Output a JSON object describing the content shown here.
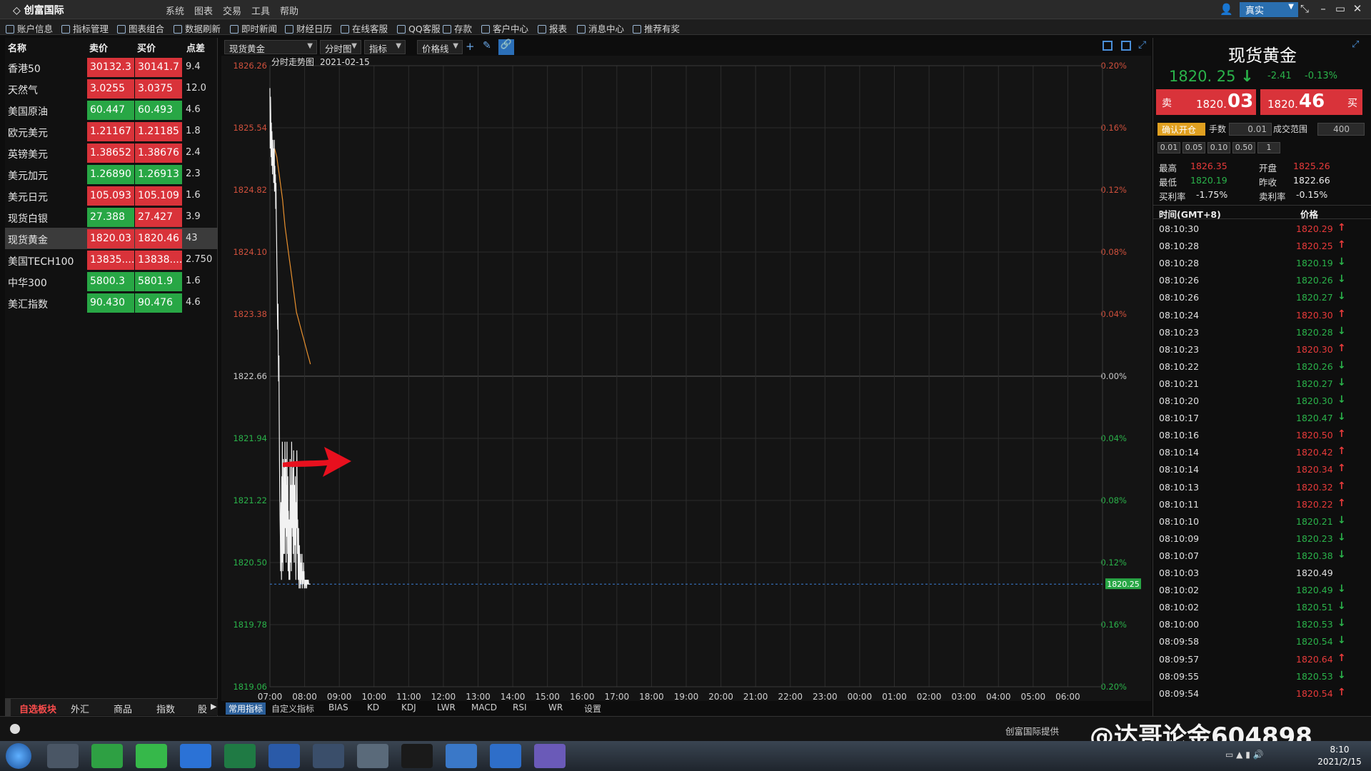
{
  "app": {
    "title": "创富国际",
    "menu": [
      "系统",
      "图表",
      "交易",
      "工具",
      "帮助"
    ],
    "mode": "真实"
  },
  "toolbar": {
    "items": [
      "账户信息",
      "指标管理",
      "图表组合",
      "数据刷新",
      "即时新闻",
      "财经日历",
      "在线客服",
      "QQ客服",
      "存款",
      "客户中心",
      "报表",
      "消息中心",
      "推荐有奖"
    ]
  },
  "quotes": {
    "headers": {
      "name": "名称",
      "sell": "卖价",
      "buy": "买价",
      "spread": "点差"
    },
    "rows": [
      {
        "name": "香港50",
        "sell": "30132.3",
        "buy": "30141.7",
        "spread": "9.4",
        "sell_color": "red",
        "buy_color": "red"
      },
      {
        "name": "天然气",
        "sell": "3.0255",
        "buy": "3.0375",
        "spread": "12.0",
        "sell_color": "red",
        "buy_color": "red"
      },
      {
        "name": "美国原油",
        "sell": "60.447",
        "buy": "60.493",
        "spread": "4.6",
        "sell_color": "green",
        "buy_color": "green"
      },
      {
        "name": "欧元美元",
        "sell": "1.21167",
        "buy": "1.21185",
        "spread": "1.8",
        "sell_color": "red",
        "buy_color": "red"
      },
      {
        "name": "英镑美元",
        "sell": "1.38652",
        "buy": "1.38676",
        "spread": "2.4",
        "sell_color": "red",
        "buy_color": "red"
      },
      {
        "name": "美元加元",
        "sell": "1.26890",
        "buy": "1.26913",
        "spread": "2.3",
        "sell_color": "green",
        "buy_color": "green"
      },
      {
        "name": "美元日元",
        "sell": "105.093",
        "buy": "105.109",
        "spread": "1.6",
        "sell_color": "red",
        "buy_color": "red"
      },
      {
        "name": "现货白银",
        "sell": "27.388",
        "buy": "27.427",
        "spread": "3.9",
        "sell_color": "green",
        "buy_color": "red"
      },
      {
        "name": "现货黄金",
        "sell": "1820.03",
        "buy": "1820.46",
        "spread": "43",
        "sell_color": "red",
        "buy_color": "red"
      },
      {
        "name": "美国TECH100",
        "sell": "13835....",
        "buy": "13838....",
        "spread": "2.750",
        "sell_color": "red",
        "buy_color": "red"
      },
      {
        "name": "中华300",
        "sell": "5800.3",
        "buy": "5801.9",
        "spread": "1.6",
        "sell_color": "green",
        "buy_color": "green"
      },
      {
        "name": "美汇指数",
        "sell": "90.430",
        "buy": "90.476",
        "spread": "4.6",
        "sell_color": "green",
        "buy_color": "green"
      }
    ],
    "tabs": [
      "自选板块",
      "外汇",
      "商品",
      "指数",
      "股"
    ]
  },
  "chart_toolbar": {
    "symbol": "现货黄金",
    "period": "分时图",
    "indicator": "指标",
    "line": "价格线"
  },
  "chart_data": {
    "type": "line",
    "title": "分时走势图",
    "date": "2021-02-15",
    "y_ticks": [
      "1826.26",
      "1825.54",
      "1824.82",
      "1824.10",
      "1823.38",
      "1822.66",
      "1821.94",
      "1821.22",
      "1820.50",
      "1819.78",
      "1819.06"
    ],
    "pct_ticks": [
      "0.20%",
      "0.16%",
      "0.12%",
      "0.08%",
      "0.04%",
      "0.00%",
      "0.04%",
      "0.08%",
      "0.12%",
      "0.16%",
      "0.20%"
    ],
    "x_ticks": [
      "07:00",
      "08:00",
      "09:00",
      "10:00",
      "11:00",
      "12:00",
      "13:00",
      "14:00",
      "15:00",
      "16:00",
      "17:00",
      "18:00",
      "19:00",
      "20:00",
      "21:00",
      "22:00",
      "23:00",
      "00:00",
      "01:00",
      "02:00",
      "03:00",
      "04:00",
      "05:00",
      "06:00"
    ],
    "ylim": [
      1819.06,
      1826.26
    ],
    "previous_close": 1822.66,
    "current_price_label": "1820.25",
    "current_price": 1820.25,
    "price_series": {
      "name": "price",
      "x_minutes_after_0700": [
        0,
        0.5,
        1,
        1.5,
        2,
        2.5,
        3,
        3.5,
        4,
        4.5,
        5,
        5.5,
        6,
        6.5,
        7,
        7.5,
        8,
        8.5,
        9,
        9.5,
        10,
        10.5,
        11,
        11.5,
        12,
        12.5,
        13,
        13.5,
        14,
        14.5,
        15,
        15.5,
        16,
        16.5,
        17,
        17.5,
        18,
        18.5,
        19,
        19.5,
        20,
        20.5,
        21,
        21.5,
        22,
        22.5,
        23,
        23.5,
        24,
        24.5,
        25,
        25.5,
        26,
        26.5,
        27,
        27.5,
        28,
        28.5,
        29,
        29.5,
        30,
        30.5,
        31,
        31.5,
        32,
        32.5,
        33,
        33.5,
        34,
        34.5,
        35,
        35.5,
        36,
        36.5,
        37,
        37.5,
        38,
        38.5,
        39,
        39.5,
        40,
        40.5,
        41,
        41.5,
        42,
        42.5,
        43,
        43.5,
        44,
        44.5,
        45,
        45.5,
        46,
        46.5,
        47,
        47.5,
        48,
        48.5,
        49,
        49.5,
        50,
        50.5,
        51,
        51.5,
        52,
        52.5,
        53,
        53.5,
        54,
        54.5,
        55,
        55.5,
        56,
        56.5,
        57,
        57.5,
        58,
        58.5,
        59,
        59.5,
        60,
        60.5,
        61,
        61.5,
        62,
        62.5,
        63,
        63.5,
        64,
        64.5,
        65,
        65.5,
        66,
        66.5,
        67,
        67.5,
        68,
        68.5,
        69,
        69.5,
        70
      ],
      "y": [
        1826.0,
        1825.3,
        1825.9,
        1825.7,
        1825.2,
        1825.6,
        1825.1,
        1825.5,
        1825.3,
        1825.0,
        1825.4,
        1825.1,
        1825.3,
        1824.9,
        1825.2,
        1825.4,
        1824.8,
        1825.1,
        1824.9,
        1825.0,
        1824.6,
        1824.9,
        1824.5,
        1824.3,
        1824.0,
        1823.8,
        1823.4,
        1823.2,
        1823.5,
        1823.0,
        1822.6,
        1822.9,
        1822.2,
        1821.7,
        1821.3,
        1821.0,
        1820.8,
        1820.4,
        1821.2,
        1820.6,
        1820.3,
        1821.5,
        1820.5,
        1821.9,
        1820.7,
        1820.4,
        1821.2,
        1821.7,
        1820.6,
        1821.1,
        1821.6,
        1820.6,
        1821.9,
        1821.3,
        1820.9,
        1821.7,
        1820.5,
        1821.4,
        1820.8,
        1821.9,
        1821.2,
        1820.6,
        1821.5,
        1820.4,
        1821.1,
        1820.7,
        1820.3,
        1821.0,
        1820.6,
        1820.3,
        1821.7,
        1820.5,
        1821.4,
        1820.9,
        1820.4,
        1821.9,
        1821.3,
        1820.9,
        1821.4,
        1820.8,
        1821.6,
        1820.6,
        1821.8,
        1821.0,
        1820.5,
        1821.4,
        1821.1,
        1820.7,
        1821.5,
        1820.6,
        1820.3,
        1821.2,
        1820.9,
        1821.8,
        1821.3,
        1820.6,
        1821.0,
        1820.6,
        1820.3,
        1820.9,
        1820.4,
        1820.2,
        1820.7,
        1820.3,
        1820.5,
        1820.2,
        1820.6,
        1820.3,
        1820.25,
        1820.5,
        1820.3,
        1820.6,
        1820.2,
        1820.4,
        1820.3,
        1820.25,
        1820.5,
        1820.3,
        1820.4,
        1820.2,
        1820.3,
        1820.25,
        1820.3,
        1820.2,
        1820.3,
        1820.25,
        1820.3,
        1820.2,
        1820.3,
        1820.25,
        1820.3,
        1820.25,
        1820.25,
        1820.3,
        1820.25,
        1820.25,
        1820.25,
        1820.25,
        1820.25,
        1820.25,
        1820.25
      ]
    },
    "avg_series": {
      "name": "average",
      "x_minutes_after_0700": [
        8,
        10,
        12,
        14,
        16,
        18,
        20,
        22,
        24,
        26,
        28,
        30,
        32,
        34,
        36,
        38,
        40,
        42,
        44,
        46,
        48,
        50,
        52,
        54,
        56,
        58,
        60,
        62,
        64,
        66,
        68,
        70
      ],
      "y": [
        1825.3,
        1825.25,
        1825.2,
        1825.1,
        1825.0,
        1824.9,
        1824.8,
        1824.7,
        1824.55,
        1824.4,
        1824.3,
        1824.2,
        1824.1,
        1824.0,
        1823.9,
        1823.8,
        1823.7,
        1823.6,
        1823.5,
        1823.4,
        1823.35,
        1823.3,
        1823.25,
        1823.2,
        1823.15,
        1823.1,
        1823.05,
        1823.0,
        1822.95,
        1822.9,
        1822.85,
        1822.8
      ]
    },
    "grid": true
  },
  "bottom_tabs": [
    "常用指标",
    "自定义指标",
    "BIAS",
    "KD",
    "KDJ",
    "LWR",
    "MACD",
    "RSI",
    "WR",
    "设置"
  ],
  "trade": {
    "symbol": "现货黄金",
    "price": "1820. 25",
    "change": "-2.41",
    "change_pct": "-0.13%",
    "sell_label": "卖",
    "sell_price_small": "1820.",
    "sell_price_big": "03",
    "buy_label": "买",
    "buy_price_small": "1820.",
    "buy_price_big": "46",
    "confirm": "确认开仓",
    "lots_label": "手数",
    "lots_value": "0.01",
    "range_label": "成交范围",
    "range_value": "400",
    "quick_lots": [
      "0.01",
      "0.05",
      "0.10",
      "0.50",
      "1"
    ],
    "stats": {
      "high_label": "最高",
      "high": "1826.35",
      "open_label": "开盘",
      "open": "1825.26",
      "low_label": "最低",
      "low": "1820.19",
      "prev_label": "昨收",
      "prev": "1822.66",
      "buy_rate_label": "买利率",
      "buy_rate": "-1.75%",
      "sell_rate_label": "卖利率",
      "sell_rate": "-0.15%"
    }
  },
  "ticks": {
    "time_header": "时间(GMT+8)",
    "price_header": "价格",
    "rows": [
      {
        "time": "08:10:30",
        "price": "1820.29",
        "dir": "up"
      },
      {
        "time": "08:10:28",
        "price": "1820.25",
        "dir": "up"
      },
      {
        "time": "08:10:28",
        "price": "1820.19",
        "dir": "down"
      },
      {
        "time": "08:10:26",
        "price": "1820.26",
        "dir": "down"
      },
      {
        "time": "08:10:26",
        "price": "1820.27",
        "dir": "down"
      },
      {
        "time": "08:10:24",
        "price": "1820.30",
        "dir": "up"
      },
      {
        "time": "08:10:23",
        "price": "1820.28",
        "dir": "down"
      },
      {
        "time": "08:10:23",
        "price": "1820.30",
        "dir": "up"
      },
      {
        "time": "08:10:22",
        "price": "1820.26",
        "dir": "down"
      },
      {
        "time": "08:10:21",
        "price": "1820.27",
        "dir": "down"
      },
      {
        "time": "08:10:20",
        "price": "1820.30",
        "dir": "down"
      },
      {
        "time": "08:10:17",
        "price": "1820.47",
        "dir": "down"
      },
      {
        "time": "08:10:16",
        "price": "1820.50",
        "dir": "up"
      },
      {
        "time": "08:10:14",
        "price": "1820.42",
        "dir": "up"
      },
      {
        "time": "08:10:14",
        "price": "1820.34",
        "dir": "up"
      },
      {
        "time": "08:10:13",
        "price": "1820.32",
        "dir": "up"
      },
      {
        "time": "08:10:11",
        "price": "1820.22",
        "dir": "up"
      },
      {
        "time": "08:10:10",
        "price": "1820.21",
        "dir": "down"
      },
      {
        "time": "08:10:09",
        "price": "1820.23",
        "dir": "down"
      },
      {
        "time": "08:10:07",
        "price": "1820.38",
        "dir": "down"
      },
      {
        "time": "08:10:03",
        "price": "1820.49",
        "dir": "none"
      },
      {
        "time": "08:10:02",
        "price": "1820.49",
        "dir": "down"
      },
      {
        "time": "08:10:02",
        "price": "1820.51",
        "dir": "down"
      },
      {
        "time": "08:10:00",
        "price": "1820.53",
        "dir": "down"
      },
      {
        "time": "08:09:58",
        "price": "1820.54",
        "dir": "down"
      },
      {
        "time": "08:09:57",
        "price": "1820.64",
        "dir": "up"
      },
      {
        "time": "08:09:55",
        "price": "1820.53",
        "dir": "down"
      },
      {
        "time": "08:09:54",
        "price": "1820.54",
        "dir": "up"
      }
    ]
  },
  "status": {
    "provider": "创富国际提供",
    "watermark": "@达哥论金604898"
  },
  "taskbar": {
    "time": "8:10",
    "date": "2021/2/15"
  },
  "colors": {
    "up": "#e83a3a",
    "down": "#2ab34a",
    "red_cell": "#d9333a",
    "green_cell": "#28a745",
    "accent": "#2a6fb0"
  }
}
